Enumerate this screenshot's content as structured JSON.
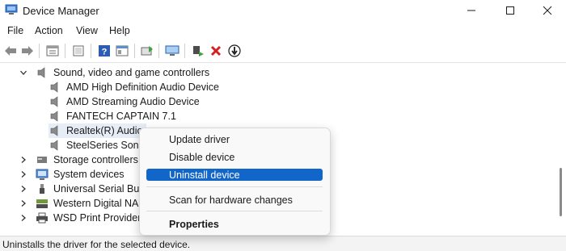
{
  "window": {
    "title": "Device Manager",
    "minimize_icon": "minimize-icon",
    "maximize_icon": "maximize-icon",
    "close_icon": "close-icon"
  },
  "menu": {
    "items": [
      "File",
      "Action",
      "View",
      "Help"
    ]
  },
  "toolbar": {
    "icons": [
      "back-arrow-icon",
      "forward-arrow-icon",
      "properties-icon",
      "show-hidden-icon",
      "help-icon",
      "action-pane-icon",
      "update-driver-icon",
      "scan-hardware-icon",
      "enable-device-icon",
      "uninstall-x-icon",
      "disable-device-icon"
    ]
  },
  "tree": {
    "category": "Sound, video and game controllers",
    "children": [
      "AMD High Definition Audio Device",
      "AMD Streaming Audio Device",
      "FANTECH CAPTAIN 7.1",
      "Realtek(R) Audio",
      "SteelSeries Sonar"
    ],
    "others": [
      "Storage controllers",
      "System devices",
      "Universal Serial Bus c",
      "Western Digital NAS",
      "WSD Print Provider"
    ]
  },
  "context_menu": {
    "items": [
      "Update driver",
      "Disable device",
      "Uninstall device",
      "Scan for hardware changes",
      "Properties"
    ],
    "highlighted": "Uninstall device"
  },
  "status": {
    "text": "Uninstalls the driver for the selected device."
  },
  "colors": {
    "highlight": "#1366c9",
    "selection": "#e6edf7"
  }
}
